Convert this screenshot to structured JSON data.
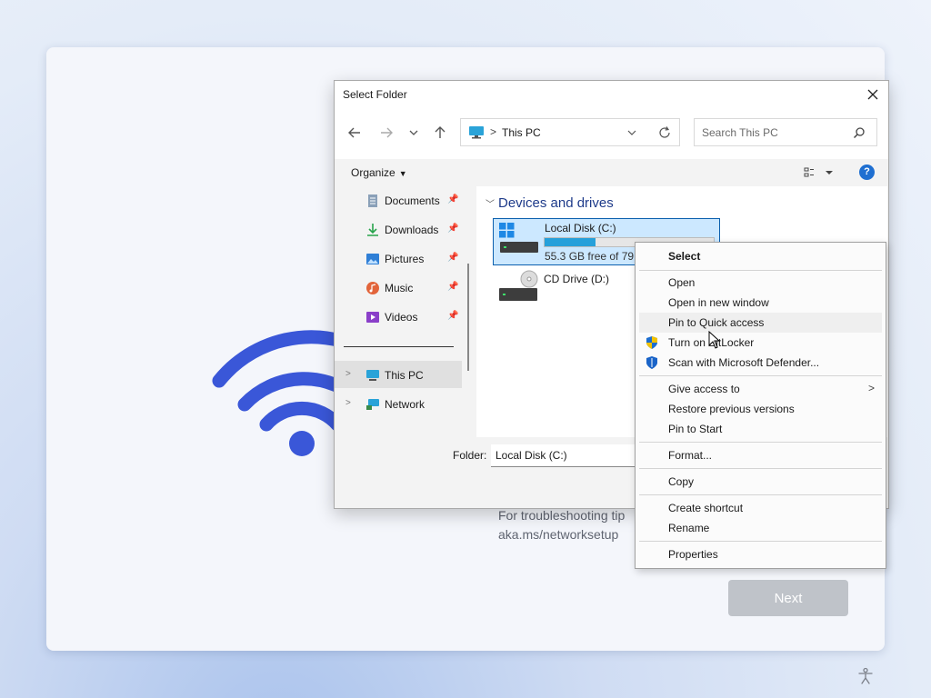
{
  "background": {
    "troubleshoot_line1": "For troubleshooting tip",
    "troubleshoot_line2": "aka.ms/networksetup",
    "next_label": "Next",
    "accent": "#3b55d6"
  },
  "dialog": {
    "title": "Select Folder",
    "address": {
      "separator": ">",
      "path": "This PC"
    },
    "search_placeholder": "Search This PC",
    "organize_label": "Organize",
    "help_label": "?",
    "nav_items": [
      {
        "label": "Documents",
        "icon": "documents-icon",
        "pinned": true
      },
      {
        "label": "Downloads",
        "icon": "downloads-icon",
        "pinned": true
      },
      {
        "label": "Pictures",
        "icon": "pictures-icon",
        "pinned": true
      },
      {
        "label": "Music",
        "icon": "music-icon",
        "pinned": true
      },
      {
        "label": "Videos",
        "icon": "videos-icon",
        "pinned": true
      },
      {
        "label": "This PC",
        "icon": "this-pc-icon",
        "selected": true
      },
      {
        "label": "Network",
        "icon": "network-icon"
      }
    ],
    "section_title": "Devices and drives",
    "drives": [
      {
        "name": "Local Disk (C:)",
        "free_text": "55.3 GB free of 79.2",
        "used_fraction": 0.3,
        "selected": true
      },
      {
        "name": "CD Drive (D:)"
      }
    ],
    "folder_label": "Folder:",
    "folder_value": "Local Disk (C:)"
  },
  "context_menu": {
    "items": [
      {
        "label": "Select",
        "bold": true
      },
      {
        "label": "Open"
      },
      {
        "label": "Open in new window"
      },
      {
        "label": "Pin to Quick access",
        "highlighted": true
      },
      {
        "label": "Turn on BitLocker",
        "icon": "shield-icon"
      },
      {
        "label": "Scan with Microsoft Defender...",
        "icon": "defender-icon"
      },
      {
        "label": "Give access to",
        "submenu": ">"
      },
      {
        "label": "Restore previous versions"
      },
      {
        "label": "Pin to Start"
      },
      {
        "label": "Format..."
      },
      {
        "label": "Copy"
      },
      {
        "label": "Create shortcut"
      },
      {
        "label": "Rename"
      },
      {
        "label": "Properties"
      }
    ]
  }
}
